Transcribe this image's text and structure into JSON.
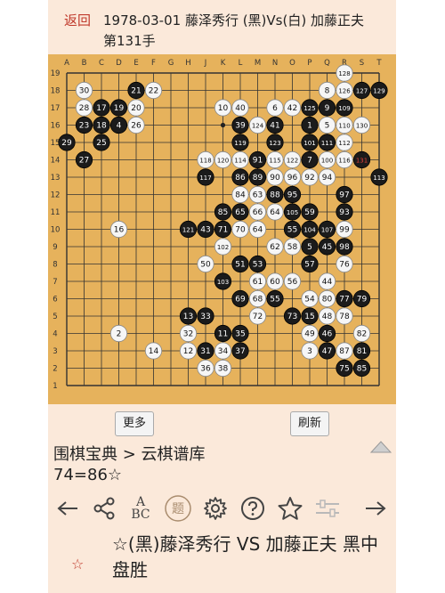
{
  "header": {
    "back_label": "返回",
    "title": "1978-03-01 藤泽秀行 (黑)Vs(白) 加藤正夫",
    "move_label": "第131手"
  },
  "board": {
    "columns": [
      "A",
      "B",
      "C",
      "D",
      "E",
      "F",
      "G",
      "H",
      "J",
      "K",
      "L",
      "M",
      "N",
      "O",
      "P",
      "Q",
      "R",
      "S",
      "T"
    ],
    "rows": [
      "19",
      "18",
      "17",
      "16",
      "15",
      "14",
      "13",
      "12",
      "11",
      "10",
      "9",
      "8",
      "7",
      "6",
      "5",
      "4",
      "3",
      "2",
      "1"
    ],
    "last_move": "S14",
    "stones": [
      {
        "p": "R19",
        "c": "w",
        "n": "128"
      },
      {
        "p": "B18",
        "c": "w",
        "n": "30"
      },
      {
        "p": "E18",
        "c": "b",
        "n": "21"
      },
      {
        "p": "F18",
        "c": "w",
        "n": "22"
      },
      {
        "p": "Q18",
        "c": "w",
        "n": "8"
      },
      {
        "p": "R18",
        "c": "w",
        "n": "126"
      },
      {
        "p": "S18",
        "c": "b",
        "n": "127"
      },
      {
        "p": "T18",
        "c": "b",
        "n": "129"
      },
      {
        "p": "B17",
        "c": "w",
        "n": "28"
      },
      {
        "p": "C17",
        "c": "b",
        "n": "17"
      },
      {
        "p": "D17",
        "c": "b",
        "n": "19"
      },
      {
        "p": "E17",
        "c": "w",
        "n": "20"
      },
      {
        "p": "K17",
        "c": "w",
        "n": "10"
      },
      {
        "p": "L17",
        "c": "w",
        "n": "40"
      },
      {
        "p": "N17",
        "c": "w",
        "n": "6"
      },
      {
        "p": "O17",
        "c": "w",
        "n": "42"
      },
      {
        "p": "P17",
        "c": "b",
        "n": "125"
      },
      {
        "p": "Q17",
        "c": "b",
        "n": "9"
      },
      {
        "p": "R17",
        "c": "b",
        "n": "109"
      },
      {
        "p": "B16",
        "c": "b",
        "n": "23"
      },
      {
        "p": "C16",
        "c": "b",
        "n": "18"
      },
      {
        "p": "D16",
        "c": "b",
        "n": "4"
      },
      {
        "p": "E16",
        "c": "w",
        "n": "26"
      },
      {
        "p": "L16",
        "c": "b",
        "n": "39"
      },
      {
        "p": "M16",
        "c": "w",
        "n": "124"
      },
      {
        "p": "N16",
        "c": "b",
        "n": "41"
      },
      {
        "p": "P16",
        "c": "b",
        "n": "1"
      },
      {
        "p": "Q16",
        "c": "w",
        "n": "5"
      },
      {
        "p": "R16",
        "c": "w",
        "n": "110"
      },
      {
        "p": "S16",
        "c": "w",
        "n": "130"
      },
      {
        "p": "A15",
        "c": "b",
        "n": "29"
      },
      {
        "p": "C15",
        "c": "b",
        "n": "25"
      },
      {
        "p": "L15",
        "c": "b",
        "n": "119"
      },
      {
        "p": "N15",
        "c": "b",
        "n": "123"
      },
      {
        "p": "P15",
        "c": "b",
        "n": "101"
      },
      {
        "p": "Q15",
        "c": "b",
        "n": "111"
      },
      {
        "p": "R15",
        "c": "w",
        "n": "112"
      },
      {
        "p": "B14",
        "c": "b",
        "n": "27"
      },
      {
        "p": "J14",
        "c": "w",
        "n": "118"
      },
      {
        "p": "K14",
        "c": "w",
        "n": "120"
      },
      {
        "p": "L14",
        "c": "w",
        "n": "114"
      },
      {
        "p": "M14",
        "c": "b",
        "n": "91"
      },
      {
        "p": "N14",
        "c": "w",
        "n": "115"
      },
      {
        "p": "O14",
        "c": "w",
        "n": "122"
      },
      {
        "p": "P14",
        "c": "b",
        "n": "7"
      },
      {
        "p": "Q14",
        "c": "w",
        "n": "100"
      },
      {
        "p": "R14",
        "c": "w",
        "n": "116"
      },
      {
        "p": "S14",
        "c": "b",
        "n": "131"
      },
      {
        "p": "J13",
        "c": "b",
        "n": "117"
      },
      {
        "p": "L13",
        "c": "b",
        "n": "86"
      },
      {
        "p": "M13",
        "c": "b",
        "n": "89"
      },
      {
        "p": "N13",
        "c": "w",
        "n": "90"
      },
      {
        "p": "O13",
        "c": "w",
        "n": "96"
      },
      {
        "p": "P13",
        "c": "w",
        "n": "92"
      },
      {
        "p": "Q13",
        "c": "w",
        "n": "94"
      },
      {
        "p": "T13",
        "c": "b",
        "n": "113"
      },
      {
        "p": "L12",
        "c": "w",
        "n": "84"
      },
      {
        "p": "M12",
        "c": "w",
        "n": "63"
      },
      {
        "p": "N12",
        "c": "b",
        "n": "88"
      },
      {
        "p": "O12",
        "c": "b",
        "n": "95"
      },
      {
        "p": "R12",
        "c": "b",
        "n": "97"
      },
      {
        "p": "K11",
        "c": "b",
        "n": "85"
      },
      {
        "p": "L11",
        "c": "b",
        "n": "65"
      },
      {
        "p": "M11",
        "c": "w",
        "n": "66"
      },
      {
        "p": "N11",
        "c": "w",
        "n": "64"
      },
      {
        "p": "O11",
        "c": "b",
        "n": "105"
      },
      {
        "p": "P11",
        "c": "b",
        "n": "59"
      },
      {
        "p": "R11",
        "c": "b",
        "n": "93"
      },
      {
        "p": "D10",
        "c": "w",
        "n": "16"
      },
      {
        "p": "H10",
        "c": "b",
        "n": "121"
      },
      {
        "p": "J10",
        "c": "b",
        "n": "43"
      },
      {
        "p": "K10",
        "c": "b",
        "n": "71"
      },
      {
        "p": "L10",
        "c": "w",
        "n": "70"
      },
      {
        "p": "M10",
        "c": "w",
        "n": "64"
      },
      {
        "p": "O10",
        "c": "b",
        "n": "55"
      },
      {
        "p": "P10",
        "c": "b",
        "n": "104"
      },
      {
        "p": "Q10",
        "c": "b",
        "n": "107"
      },
      {
        "p": "R10",
        "c": "w",
        "n": "99"
      },
      {
        "p": "K9",
        "c": "w",
        "n": "102"
      },
      {
        "p": "N9",
        "c": "w",
        "n": "62"
      },
      {
        "p": "O9",
        "c": "w",
        "n": "58"
      },
      {
        "p": "P9",
        "c": "b",
        "n": "5"
      },
      {
        "p": "Q9",
        "c": "b",
        "n": "45"
      },
      {
        "p": "R9",
        "c": "b",
        "n": "98"
      },
      {
        "p": "J8",
        "c": "w",
        "n": "50"
      },
      {
        "p": "L8",
        "c": "b",
        "n": "51"
      },
      {
        "p": "M8",
        "c": "b",
        "n": "53"
      },
      {
        "p": "P8",
        "c": "b",
        "n": "57"
      },
      {
        "p": "R8",
        "c": "w",
        "n": "76"
      },
      {
        "p": "K7",
        "c": "b",
        "n": "103"
      },
      {
        "p": "M7",
        "c": "w",
        "n": "61"
      },
      {
        "p": "N7",
        "c": "w",
        "n": "60"
      },
      {
        "p": "O7",
        "c": "w",
        "n": "56"
      },
      {
        "p": "Q7",
        "c": "w",
        "n": "44"
      },
      {
        "p": "L6",
        "c": "b",
        "n": "69"
      },
      {
        "p": "M6",
        "c": "w",
        "n": "68"
      },
      {
        "p": "N6",
        "c": "b",
        "n": "55"
      },
      {
        "p": "P6",
        "c": "w",
        "n": "54"
      },
      {
        "p": "Q6",
        "c": "w",
        "n": "80"
      },
      {
        "p": "R6",
        "c": "b",
        "n": "77"
      },
      {
        "p": "S6",
        "c": "b",
        "n": "79"
      },
      {
        "p": "H5",
        "c": "b",
        "n": "13"
      },
      {
        "p": "J5",
        "c": "b",
        "n": "33"
      },
      {
        "p": "M5",
        "c": "w",
        "n": "72"
      },
      {
        "p": "O5",
        "c": "b",
        "n": "73"
      },
      {
        "p": "P5",
        "c": "b",
        "n": "15"
      },
      {
        "p": "Q5",
        "c": "w",
        "n": "48"
      },
      {
        "p": "R5",
        "c": "w",
        "n": "78"
      },
      {
        "p": "D4",
        "c": "w",
        "n": "2"
      },
      {
        "p": "H4",
        "c": "w",
        "n": "32"
      },
      {
        "p": "K4",
        "c": "b",
        "n": "11"
      },
      {
        "p": "L4",
        "c": "b",
        "n": "35"
      },
      {
        "p": "P4",
        "c": "w",
        "n": "49"
      },
      {
        "p": "Q4",
        "c": "b",
        "n": "46"
      },
      {
        "p": "S4",
        "c": "w",
        "n": "82"
      },
      {
        "p": "F3",
        "c": "w",
        "n": "14"
      },
      {
        "p": "H3",
        "c": "w",
        "n": "12"
      },
      {
        "p": "J3",
        "c": "b",
        "n": "31"
      },
      {
        "p": "K3",
        "c": "w",
        "n": "34"
      },
      {
        "p": "L3",
        "c": "b",
        "n": "37"
      },
      {
        "p": "P3",
        "c": "w",
        "n": "3"
      },
      {
        "p": "Q3",
        "c": "b",
        "n": "47"
      },
      {
        "p": "R3",
        "c": "w",
        "n": "87"
      },
      {
        "p": "S3",
        "c": "b",
        "n": "81"
      },
      {
        "p": "J2",
        "c": "w",
        "n": "36"
      },
      {
        "p": "K2",
        "c": "w",
        "n": "38"
      },
      {
        "p": "R2",
        "c": "b",
        "n": "75"
      },
      {
        "p": "S2",
        "c": "b",
        "n": "85"
      }
    ]
  },
  "buttons": {
    "more_label": "更多",
    "refresh_label": "刷新"
  },
  "breadcrumb": "围棋宝典 > 云棋谱库",
  "move_info": "74=86☆",
  "toolbar": {
    "icons": [
      "arrow-left-icon",
      "share-icon",
      "abc-icon",
      "problem-icon",
      "gear-icon",
      "help-icon",
      "star-icon",
      "slider-icon",
      "arrow-right-icon"
    ],
    "abc_top": "A",
    "abc_bottom": "BC",
    "problem_label": "题"
  },
  "result": "☆(黑)藤泽秀行 VS 加藤正夫 黑中盘胜",
  "result_star": "☆",
  "colors": {
    "accent": "#c0392b",
    "board": "#e6b25c",
    "panel": "#fbe9da"
  }
}
